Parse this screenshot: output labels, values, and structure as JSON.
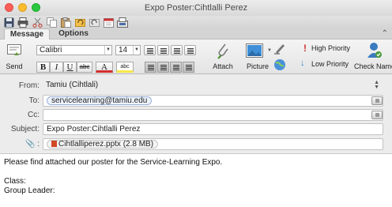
{
  "window": {
    "title": "Expo Poster:Cihtlalli Perez"
  },
  "tabs": [
    {
      "label": "Message"
    },
    {
      "label": "Options"
    }
  ],
  "ribbon": {
    "font_name": "Calibri",
    "font_size": "14",
    "bold": "B",
    "italic": "I",
    "underline": "U",
    "strike": "abc",
    "text_color_letter": "A",
    "highlight": "abc",
    "send_label": "Send",
    "attach_label": "Attach",
    "picture_label": "Picture",
    "high_priority_label": "High Priority",
    "low_priority_label": "Low Priority",
    "check_names_label": "Check Names"
  },
  "header": {
    "from_label": "From:",
    "from_value": "Tamiu (Cihtlali)",
    "to_label": "To:",
    "to_value": "servicelearning@tamiu.edu",
    "cc_label": "Cc:",
    "cc_value": "",
    "subject_label": "Subject:",
    "subject_value": "Expo Poster:Cihtlalli Perez",
    "attachment_value": "Cihtlalliperez.pptx (2.8 MB)"
  },
  "body": {
    "lines": [
      "Please find attached our poster for the Service-Learning Expo.",
      "",
      "Class:",
      "Group Leader:"
    ]
  },
  "colors": {
    "close": "#fc5f57",
    "minimize": "#fdbc2e",
    "maximize": "#28c840",
    "high_priority": "#d32f2f",
    "low_priority": "#2f7bd3",
    "token_border": "#9ab0d6"
  }
}
